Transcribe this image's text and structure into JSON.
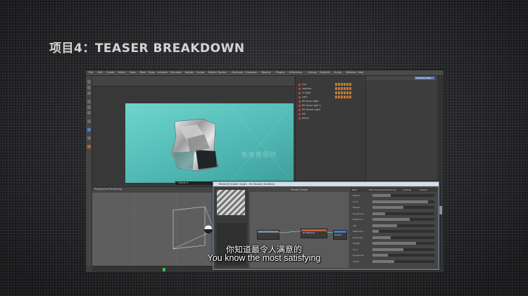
{
  "slide": {
    "title": "项目4：TEASER BREAKDOWN"
  },
  "subtitles": {
    "zh": "你知道最令人满意的",
    "en": "You know the most satisfying"
  },
  "app": {
    "menu": [
      "File",
      "Edit",
      "Create",
      "Select",
      "Tools",
      "Mesh",
      "Snap",
      "Animate",
      "Simulate",
      "Render",
      "Sculpt",
      "Motion Tracker",
      "MoGraph",
      "Character",
      "Pipeline",
      "Plugins",
      "X-Particles",
      "Octane",
      "Redshift",
      "Script",
      "Window",
      "Help"
    ],
    "layout_label": "Standard (RS)",
    "render_window_status": "Frame 0",
    "watermark": "鱼鱼教程网",
    "object_manager_items": [
      "null",
      "camera",
      "rs light",
      "cam",
      "RS Area Light",
      "RS Area Light.1",
      "RS Dome Light",
      "foil",
      "plane"
    ],
    "bottom_viewport_header": "Progressive Rendering",
    "shader_graph": {
      "title": "Redshift Shader Graph - RS Shader (Untitled)",
      "center_header": "Shader Graph",
      "node_label": "RS Material",
      "output_label": "Output",
      "tabs": [
        "Basic",
        "Base Properties",
        "Advanced",
        "Coating",
        "Overall"
      ],
      "params": [
        "Diffuse",
        "Color",
        "Weight",
        "Roughness",
        "Reflection",
        "IOR",
        "Metalness",
        "Refraction",
        "Weight",
        "Color",
        "Roughness",
        "Sheen"
      ]
    },
    "colors": {
      "render_bg": "#56c2bd",
      "accent_red": "#d9473b",
      "accent_orange": "#c87a2b",
      "window_border": "#6c8fb5"
    }
  }
}
